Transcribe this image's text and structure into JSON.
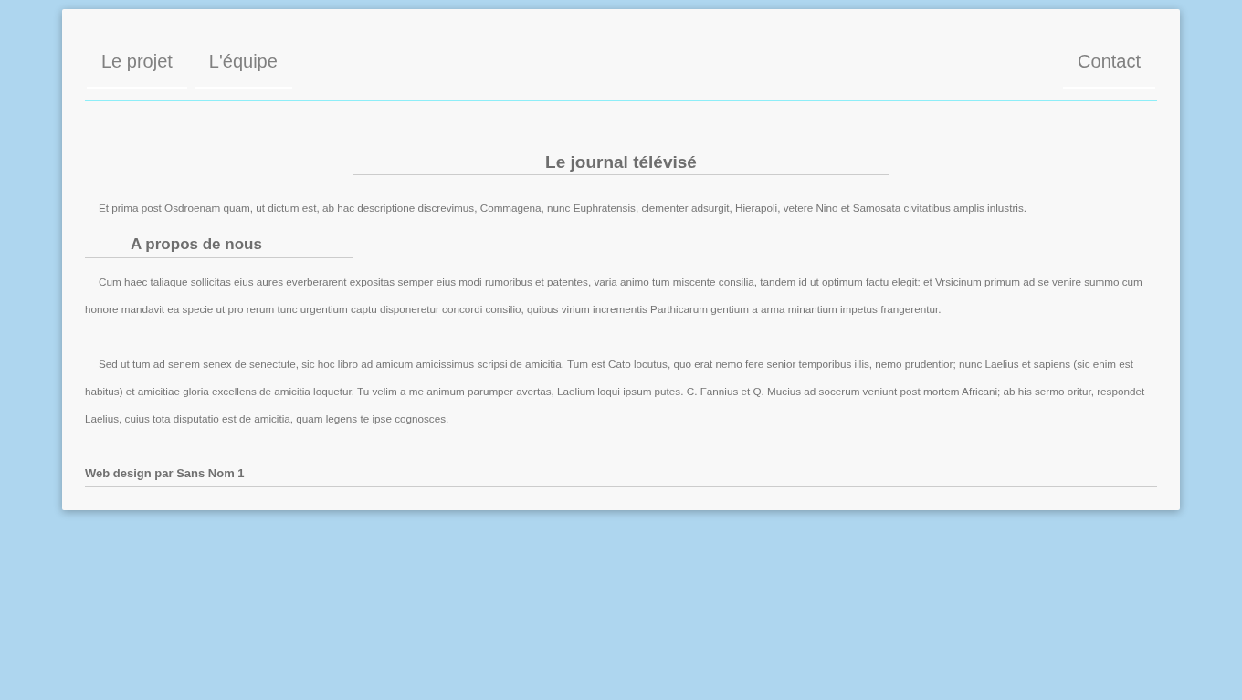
{
  "nav": {
    "links": [
      {
        "label": "Le projet"
      },
      {
        "label": "L'équipe"
      }
    ],
    "right_links": [
      {
        "label": "Contact"
      }
    ]
  },
  "sections": [
    {
      "kind": "centered",
      "title": "Le journal télévisé",
      "paragraphs": [
        "Et prima post Osdroenam quam, ut dictum est, ab hac descriptione discrevimus, Commagena, nunc Euphratensis, clementer adsurgit, Hierapoli, vetere Nino et Samosata civitatibus amplis inlustris."
      ]
    },
    {
      "kind": "left",
      "title": "A propos de nous",
      "paragraphs": [
        "Cum haec taliaque sollicitas eius aures everberarent expositas semper eius modi rumoribus et patentes, varia animo tum miscente consilia, tandem id ut optimum factu elegit: et Vrsicinum primum ad se venire summo cum honore mandavit ea specie ut pro rerum tunc urgentium captu disponeretur concordi consilio, quibus virium incrementis Parthicarum gentium a arma minantium impetus frangerentur.",
        "Sed ut tum ad senem senex de senectute, sic hoc libro ad amicum amicissimus scripsi de amicitia. Tum est Cato locutus, quo erat nemo fere senior temporibus illis, nemo prudentior; nunc Laelius et sapiens (sic enim est habitus) et amicitiae gloria excellens de amicitia loquetur. Tu velim a me animum parumper avertas, Laelium loqui ipsum putes. C. Fannius et Q. Mucius ad socerum veniunt post mortem Africani; ab his sermo oritur, respondet Laelius, cuius tota disputatio est de amicitia, quam legens te ipse cognosces."
      ]
    }
  ],
  "footer": {
    "text": "Web design par Sans Nom 1"
  }
}
